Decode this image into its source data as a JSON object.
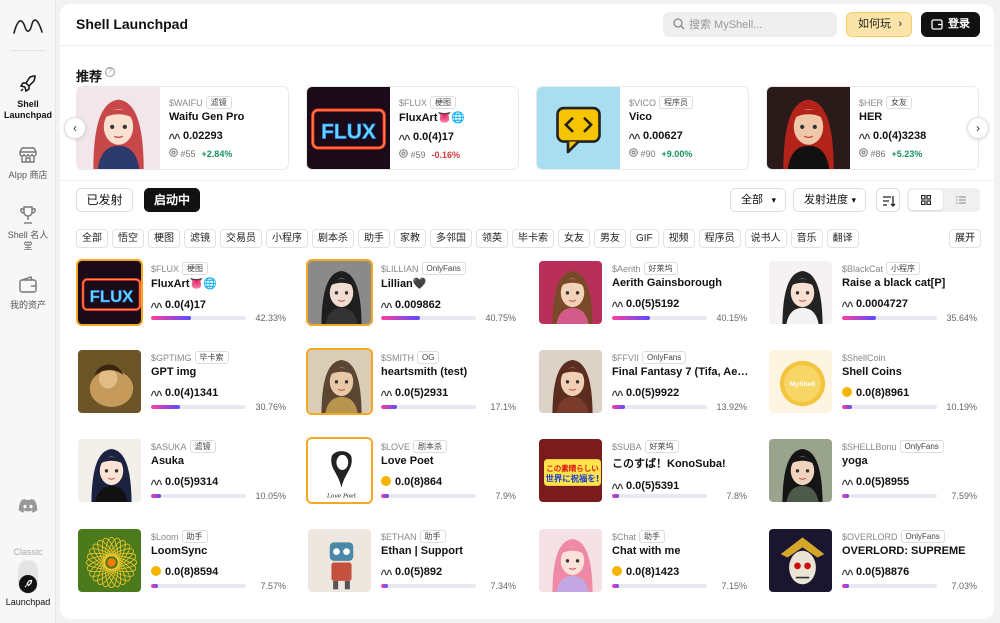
{
  "rail": {
    "items": [
      {
        "label": "Shell Launchpad",
        "icon": "rocket-icon",
        "active": true
      },
      {
        "label": "AIpp 商店",
        "icon": "store-icon",
        "active": false
      },
      {
        "label": "Shell 名人堂",
        "icon": "trophy-icon",
        "active": false
      },
      {
        "label": "我的资产",
        "icon": "wallet-icon",
        "active": false
      }
    ],
    "classic_label": "Classic",
    "launchpad_label": "Launchpad"
  },
  "header": {
    "title": "Shell Launchpad",
    "search_placeholder": "搜索 MyShell...",
    "howto_label": "如何玩",
    "login_label": "登录"
  },
  "recommended": {
    "title": "推荐",
    "help_glyph": "?",
    "items": [
      {
        "ticker": "$WAIFU",
        "tag": "滤镜",
        "name": "Waifu Gen Pro",
        "price": "0.02293",
        "rank": "#55",
        "change": "+2.84%",
        "dir": "up",
        "img": "anime-redhair"
      },
      {
        "ticker": "$FLUX",
        "tag": "梗图",
        "name": "FluxArt👅🌐",
        "price": "0.0(4)17",
        "rank": "#59",
        "change": "-0.16%",
        "dir": "down",
        "img": "flux"
      },
      {
        "ticker": "$VICO",
        "tag": "程序员",
        "name": "Vico",
        "price": "0.00627",
        "rank": "#90",
        "change": "+9.00%",
        "dir": "up",
        "img": "vico"
      },
      {
        "ticker": "$HER",
        "tag": "女友",
        "name": "HER",
        "price": "0.0(4)3238",
        "rank": "#86",
        "change": "+5.23%",
        "dir": "up",
        "img": "redhead"
      }
    ]
  },
  "tabs": {
    "launched": "已发射",
    "launching": "启动中"
  },
  "filters": {
    "all": "全部",
    "progress": "发射进度"
  },
  "categories": [
    "全部",
    "悟空",
    "梗图",
    "滤镜",
    "交易员",
    "小程序",
    "剧本杀",
    "助手",
    "家教",
    "多邻国",
    "领英",
    "毕卡索",
    "女友",
    "男友",
    "GIF",
    "视频",
    "程序员",
    "说书人",
    "音乐",
    "翻译"
  ],
  "expand_label": "展开",
  "tokens": [
    {
      "ticker": "$FLUX",
      "tag": "梗图",
      "name": "FluxArt👅🌐",
      "price": "0.0(4)17",
      "progress": "42.33%",
      "pct": 42.33,
      "coin": "shell",
      "img": "flux",
      "ring": true
    },
    {
      "ticker": "$LILLIAN",
      "tag": "OnlyFans",
      "name": "Lillian🖤",
      "price": "0.009862",
      "progress": "40.75%",
      "pct": 40.75,
      "coin": "shell",
      "img": "gothic",
      "ring": true
    },
    {
      "ticker": "$Aerith",
      "tag": "好莱坞",
      "name": "Aerith Gainsborough",
      "price": "0.0(5)5192",
      "progress": "40.15%",
      "pct": 40.15,
      "coin": "shell",
      "img": "aerith",
      "ring": false
    },
    {
      "ticker": "$BlackCat",
      "tag": "小程序",
      "name": "Raise a black cat[P]",
      "price": "0.0004727",
      "progress": "35.64%",
      "pct": 35.64,
      "coin": "shell",
      "img": "catgirl",
      "ring": false
    },
    {
      "ticker": "$GPTIMG",
      "tag": "毕卡索",
      "name": "GPT img",
      "price": "0.0(4)1341",
      "progress": "30.76%",
      "pct": 30.76,
      "coin": "shell",
      "img": "painting",
      "ring": false
    },
    {
      "ticker": "$SMITH",
      "tag": "OG",
      "name": "heartsmith (test)",
      "price": "0.0(5)2931",
      "progress": "17.1%",
      "pct": 17.1,
      "coin": "shell",
      "img": "warrior",
      "ring": true
    },
    {
      "ticker": "$FFVII",
      "tag": "OnlyFans",
      "name": "Final Fantasy 7 (Tifa, Aerith, Yuffie)",
      "price": "0.0(5)9922",
      "progress": "13.92%",
      "pct": 13.92,
      "coin": "shell",
      "img": "ff7",
      "ring": false
    },
    {
      "ticker": "$ShellCoin",
      "tag": "",
      "name": "Shell Coins",
      "price": "0.0(8)8961",
      "progress": "10.19%",
      "pct": 10.19,
      "coin": "gold",
      "img": "coin",
      "ring": false
    },
    {
      "ticker": "$ASUKA",
      "tag": "滤镜",
      "name": "Asuka",
      "price": "0.0(5)9314",
      "progress": "10.05%",
      "pct": 10.05,
      "coin": "shell",
      "img": "maid",
      "ring": false
    },
    {
      "ticker": "$LOVE",
      "tag": "剧本杀",
      "name": "Love Poet",
      "price": "0.0(8)864",
      "progress": "7.9%",
      "pct": 7.9,
      "coin": "gold",
      "img": "lovepoet",
      "ring": true
    },
    {
      "ticker": "$SUBA",
      "tag": "好莱坞",
      "name": "このすば！KonoSuba!",
      "price": "0.0(5)5391",
      "progress": "7.8%",
      "pct": 7.8,
      "coin": "shell",
      "img": "konosuba",
      "ring": false
    },
    {
      "ticker": "$SHELLBonu",
      "tag": "OnlyFans",
      "name": "yoga",
      "price": "0.0(5)8955",
      "progress": "7.59%",
      "pct": 7.59,
      "coin": "shell",
      "img": "yoga",
      "ring": false
    },
    {
      "ticker": "$Loom",
      "tag": "助手",
      "name": "LoomSync",
      "price": "0.0(8)8594",
      "progress": "7.57%",
      "pct": 7.57,
      "coin": "gold",
      "img": "loom",
      "ring": false
    },
    {
      "ticker": "$ETHAN",
      "tag": "助手",
      "name": "Ethan | Support",
      "price": "0.0(5)892",
      "progress": "7.34%",
      "pct": 7.34,
      "coin": "shell",
      "img": "robot",
      "ring": false
    },
    {
      "ticker": "$Chat",
      "tag": "助手",
      "name": "Chat with me",
      "price": "0.0(8)1423",
      "progress": "7.15%",
      "pct": 7.15,
      "coin": "gold",
      "img": "pinkhair",
      "ring": false
    },
    {
      "ticker": "$OVERLORD",
      "tag": "OnlyFans",
      "name": "OVERLORD: SUPREME",
      "price": "0.0(5)8876",
      "progress": "7.03%",
      "pct": 7.03,
      "coin": "shell",
      "img": "overlord",
      "ring": false
    }
  ],
  "colors": {
    "accent_dark": "#111111",
    "howto_bg": "#fbe4a8",
    "up": "#17935a",
    "down": "#d23c3c",
    "progress_start": "#ff3da0",
    "progress_end": "#5b4bff"
  }
}
